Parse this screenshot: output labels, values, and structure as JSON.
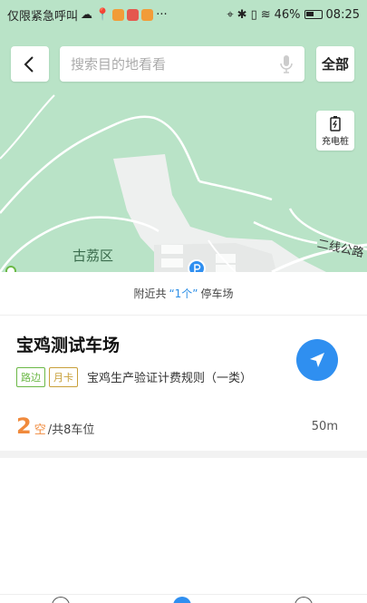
{
  "status_bar": {
    "carrier_text": "仅限紧急呼叫",
    "more_text": "···",
    "battery": "46%",
    "time": "08:25",
    "app_icon_colors": [
      "#e24b3b",
      "#f29c38",
      "#e5584e",
      "#f29c38"
    ]
  },
  "search": {
    "placeholder": "搜索目的地看看",
    "all_label": "全部"
  },
  "map": {
    "charging_label": "充电桩",
    "district_label": "古荔区",
    "road_label": "二线公路"
  },
  "nearby": {
    "prefix": "附近共",
    "count": "“1个”",
    "suffix": "停车场"
  },
  "parking": {
    "name": "宝鸡测试车场",
    "tags": [
      "路边",
      "月卡"
    ],
    "rule": "宝鸡生产验证计费规则（一类）",
    "available": "2",
    "available_label": "空",
    "total": "/共8车位",
    "distance": "50m"
  },
  "colors": {
    "map_green": "#b9e3c7",
    "accent_blue": "#2f8ff0",
    "available_orange": "#f08a3c",
    "tag_green": "#6bb846",
    "tag_gold": "#c8a03a"
  },
  "icons": [
    "back-arrow-icon",
    "microphone-icon",
    "battery-charge-icon",
    "navigate-icon",
    "parking-marker-icon"
  ]
}
